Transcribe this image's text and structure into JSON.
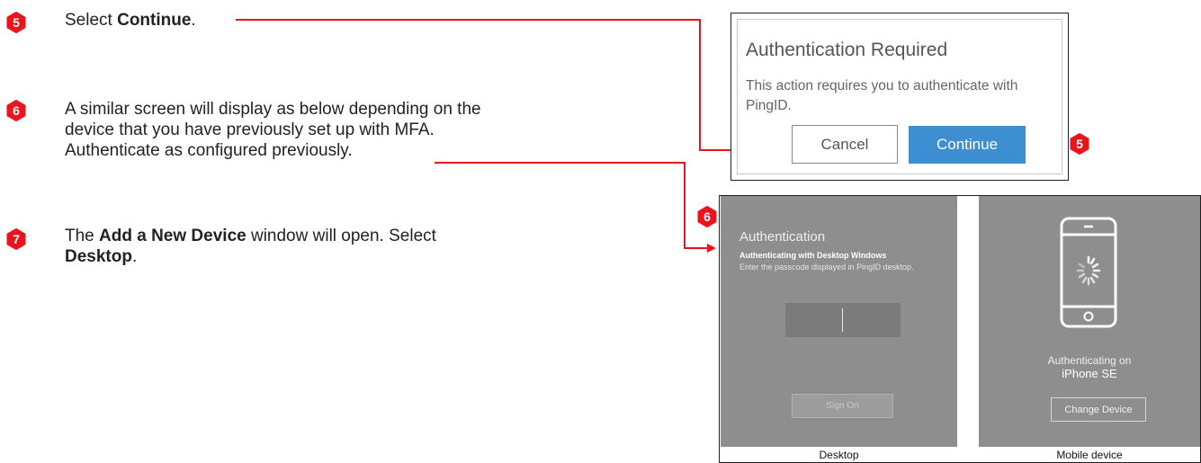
{
  "steps": [
    {
      "number": "5",
      "text_pre": "Select ",
      "text_bold": "Continue",
      "text_post": "."
    },
    {
      "number": "6",
      "line1": "A similar screen will display as below depending on the",
      "line2": "device that you have previously set up with MFA.",
      "line3": "Authenticate as configured previously."
    },
    {
      "number": "7",
      "text_pre": "The ",
      "text_bold": "Add a New Device",
      "text_post": " window will open. Select",
      "text_bold2": "Desktop",
      "text_post2": "."
    }
  ],
  "dialog": {
    "title": "Authentication Required",
    "message": "This action requires you to authenticate with PingID.",
    "cancel_label": "Cancel",
    "continue_label": "Continue"
  },
  "callouts": {
    "dialog_badge": "5",
    "panel_badge": "6"
  },
  "desktop_panel": {
    "title": "Authentication",
    "subtitle": "Authenticating with Desktop Windows",
    "hint": "Enter the passcode displayed in PingID desktop.",
    "sign_on_label": "Sign On",
    "caption": "Desktop"
  },
  "mobile_panel": {
    "status": "Authenticating on",
    "device": "iPhone SE",
    "change_label": "Change Device",
    "caption": "Mobile device"
  },
  "colors": {
    "accent_red": "#e8151c",
    "continue_blue": "#3d8fd1",
    "panel_gray": "#8e8e8e"
  }
}
